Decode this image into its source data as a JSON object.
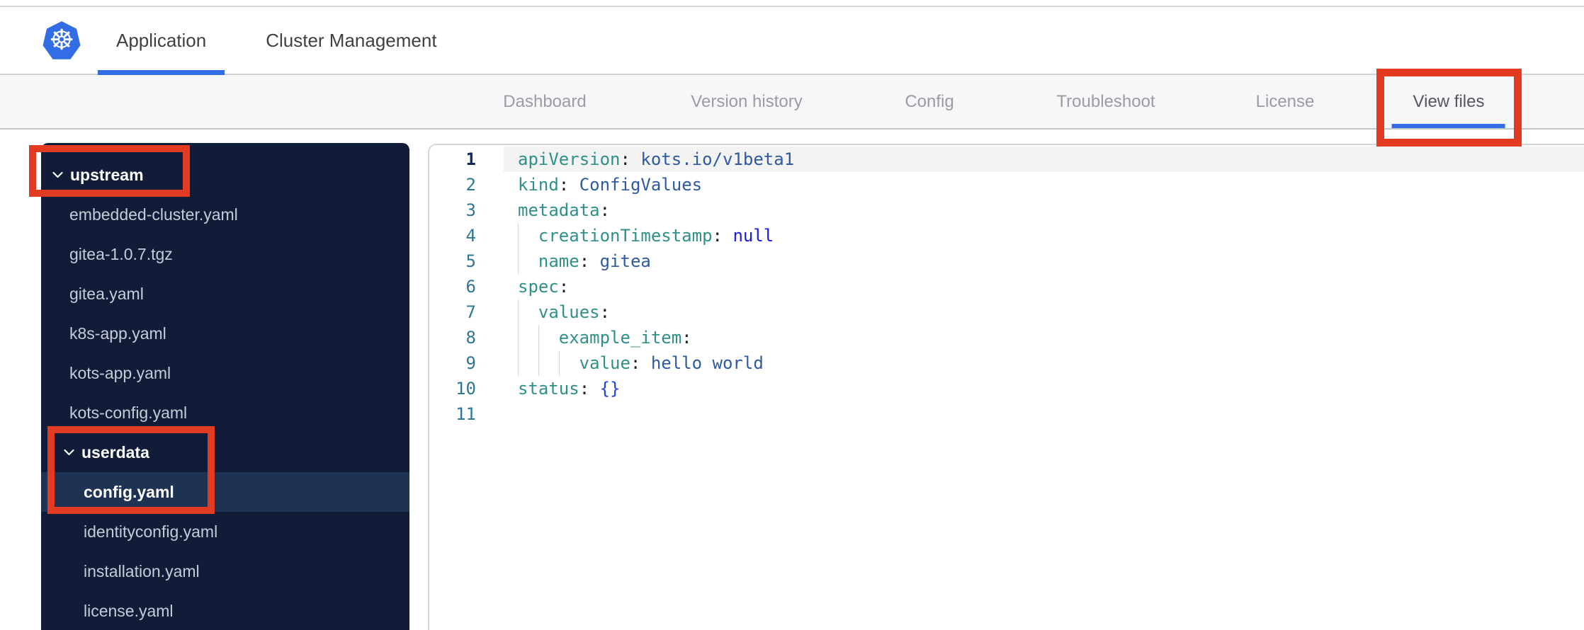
{
  "colors": {
    "annotation-red": "#e23b22",
    "brand-blue": "#326de6",
    "sidebar-bg": "#111d38",
    "sidebar-selected": "#1e3253",
    "code-key": "#2f9089",
    "code-value": "#2d5aa0",
    "code-keyword": "#1a1ae0",
    "code-bracket": "#1e41e8",
    "line-number": "#2d7795",
    "active-line-number": "#16295c"
  },
  "header": {
    "logo": "kubernetes-logo",
    "logo_glyph": "☸",
    "tabs": [
      {
        "label": "Application",
        "active": true
      },
      {
        "label": "Cluster Management",
        "active": false
      }
    ]
  },
  "subnav": {
    "tabs": [
      {
        "label": "Dashboard",
        "active": false
      },
      {
        "label": "Version history",
        "active": false
      },
      {
        "label": "Config",
        "active": false
      },
      {
        "label": "Troubleshoot",
        "active": false
      },
      {
        "label": "License",
        "active": false
      },
      {
        "label": "View files",
        "active": true,
        "annotated": true
      }
    ]
  },
  "file_tree": {
    "items": [
      {
        "label": "upstream",
        "type": "folder",
        "level": 0,
        "expanded": true,
        "annotated": true
      },
      {
        "label": "embedded-cluster.yaml",
        "type": "file",
        "level": 1
      },
      {
        "label": "gitea-1.0.7.tgz",
        "type": "file",
        "level": 1
      },
      {
        "label": "gitea.yaml",
        "type": "file",
        "level": 1
      },
      {
        "label": "k8s-app.yaml",
        "type": "file",
        "level": 1
      },
      {
        "label": "kots-app.yaml",
        "type": "file",
        "level": 1
      },
      {
        "label": "kots-config.yaml",
        "type": "file",
        "level": 1
      },
      {
        "label": "userdata",
        "type": "folder",
        "level": 1,
        "expanded": true,
        "annotated": true
      },
      {
        "label": "config.yaml",
        "type": "file",
        "level": 2,
        "selected": true,
        "annotated": true
      },
      {
        "label": "identityconfig.yaml",
        "type": "file",
        "level": 2
      },
      {
        "label": "installation.yaml",
        "type": "file",
        "level": 2
      },
      {
        "label": "license.yaml",
        "type": "file",
        "level": 2
      }
    ]
  },
  "editor": {
    "language": "yaml",
    "open_file": "config.yaml",
    "lines": [
      {
        "n": 1,
        "indent": 0,
        "active": true,
        "tokens": [
          {
            "c": "key",
            "s": "apiVersion"
          },
          {
            "c": "punct",
            "s": ": "
          },
          {
            "c": "val",
            "s": "kots.io/v1beta1"
          }
        ]
      },
      {
        "n": 2,
        "indent": 0,
        "tokens": [
          {
            "c": "key",
            "s": "kind"
          },
          {
            "c": "punct",
            "s": ": "
          },
          {
            "c": "val",
            "s": "ConfigValues"
          }
        ]
      },
      {
        "n": 3,
        "indent": 0,
        "tokens": [
          {
            "c": "key",
            "s": "metadata"
          },
          {
            "c": "punct",
            "s": ":"
          }
        ]
      },
      {
        "n": 4,
        "indent": 2,
        "tokens": [
          {
            "c": "key",
            "s": "creationTimestamp"
          },
          {
            "c": "punct",
            "s": ": "
          },
          {
            "c": "kw",
            "s": "null"
          }
        ]
      },
      {
        "n": 5,
        "indent": 2,
        "tokens": [
          {
            "c": "key",
            "s": "name"
          },
          {
            "c": "punct",
            "s": ": "
          },
          {
            "c": "val",
            "s": "gitea"
          }
        ]
      },
      {
        "n": 6,
        "indent": 0,
        "tokens": [
          {
            "c": "key",
            "s": "spec"
          },
          {
            "c": "punct",
            "s": ":"
          }
        ]
      },
      {
        "n": 7,
        "indent": 2,
        "tokens": [
          {
            "c": "key",
            "s": "values"
          },
          {
            "c": "punct",
            "s": ":"
          }
        ]
      },
      {
        "n": 8,
        "indent": 4,
        "tokens": [
          {
            "c": "key",
            "s": "example_item"
          },
          {
            "c": "punct",
            "s": ":"
          }
        ]
      },
      {
        "n": 9,
        "indent": 6,
        "tokens": [
          {
            "c": "key",
            "s": "value"
          },
          {
            "c": "punct",
            "s": ": "
          },
          {
            "c": "val",
            "s": "hello world"
          }
        ]
      },
      {
        "n": 10,
        "indent": 0,
        "tokens": [
          {
            "c": "key",
            "s": "status"
          },
          {
            "c": "punct",
            "s": ": "
          },
          {
            "c": "bracket",
            "s": "{}"
          }
        ]
      },
      {
        "n": 11,
        "indent": 0,
        "tokens": []
      }
    ]
  },
  "annotations": {
    "color": "#e23b22",
    "boxes": [
      "view-files-tab",
      "upstream-folder",
      "userdata-and-config-yaml"
    ]
  }
}
